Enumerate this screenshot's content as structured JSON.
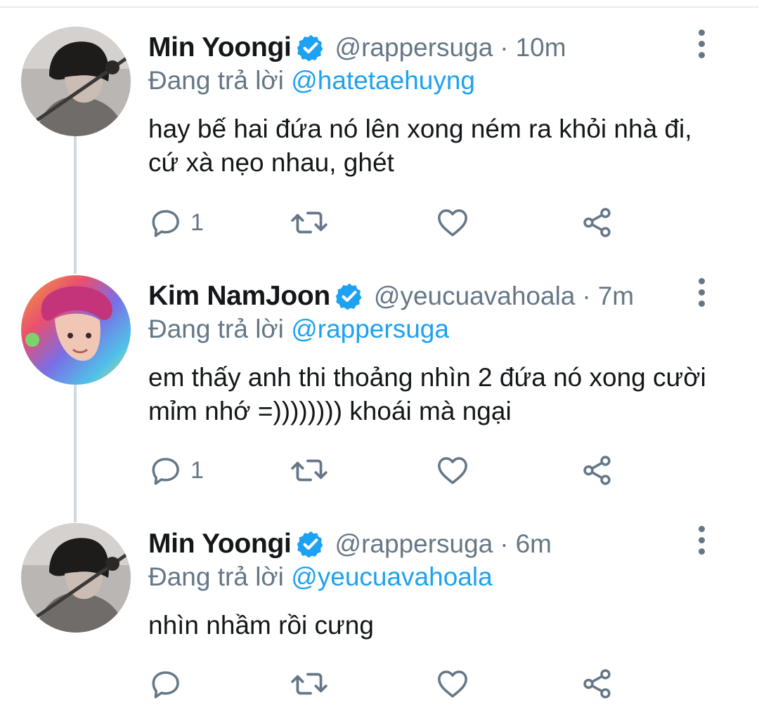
{
  "colors": {
    "text": "#14171a",
    "secondary": "#657786",
    "accent": "#1da1f2",
    "thread_line": "#cfd9de"
  },
  "tweets": [
    {
      "name": "Min Yoongi",
      "handle": "@rappersuga",
      "separator": "·",
      "time": "10m",
      "replying_prefix": "Đang trả lời ",
      "replying_to": "@hatetaehuyng",
      "text": "hay bế hai đứa nó lên xong ném ra khỏi nhà đi, cứ xà nẹo nhau, ghét",
      "reply_count": "1",
      "avatar": "avatar-dark-hair-icon"
    },
    {
      "name": "Kim NamJoon",
      "handle": "@yeucuavahoala",
      "separator": "·",
      "time": "7m",
      "replying_prefix": "Đang trả lời ",
      "replying_to": "@rappersuga",
      "text": "em thấy anh thi thoảng nhìn 2 đứa nó xong cười mỉm nhớ =)))))))) khoái mà ngại",
      "reply_count": "1",
      "avatar": "avatar-rainbow-icon"
    },
    {
      "name": "Min Yoongi",
      "handle": "@rappersuga",
      "separator": "·",
      "time": "6m",
      "replying_prefix": "Đang trả lời ",
      "replying_to": "@yeucuavahoala",
      "text": "nhìn nhầm rồi cưng",
      "reply_count": "",
      "avatar": "avatar-dark-hair-icon"
    }
  ]
}
